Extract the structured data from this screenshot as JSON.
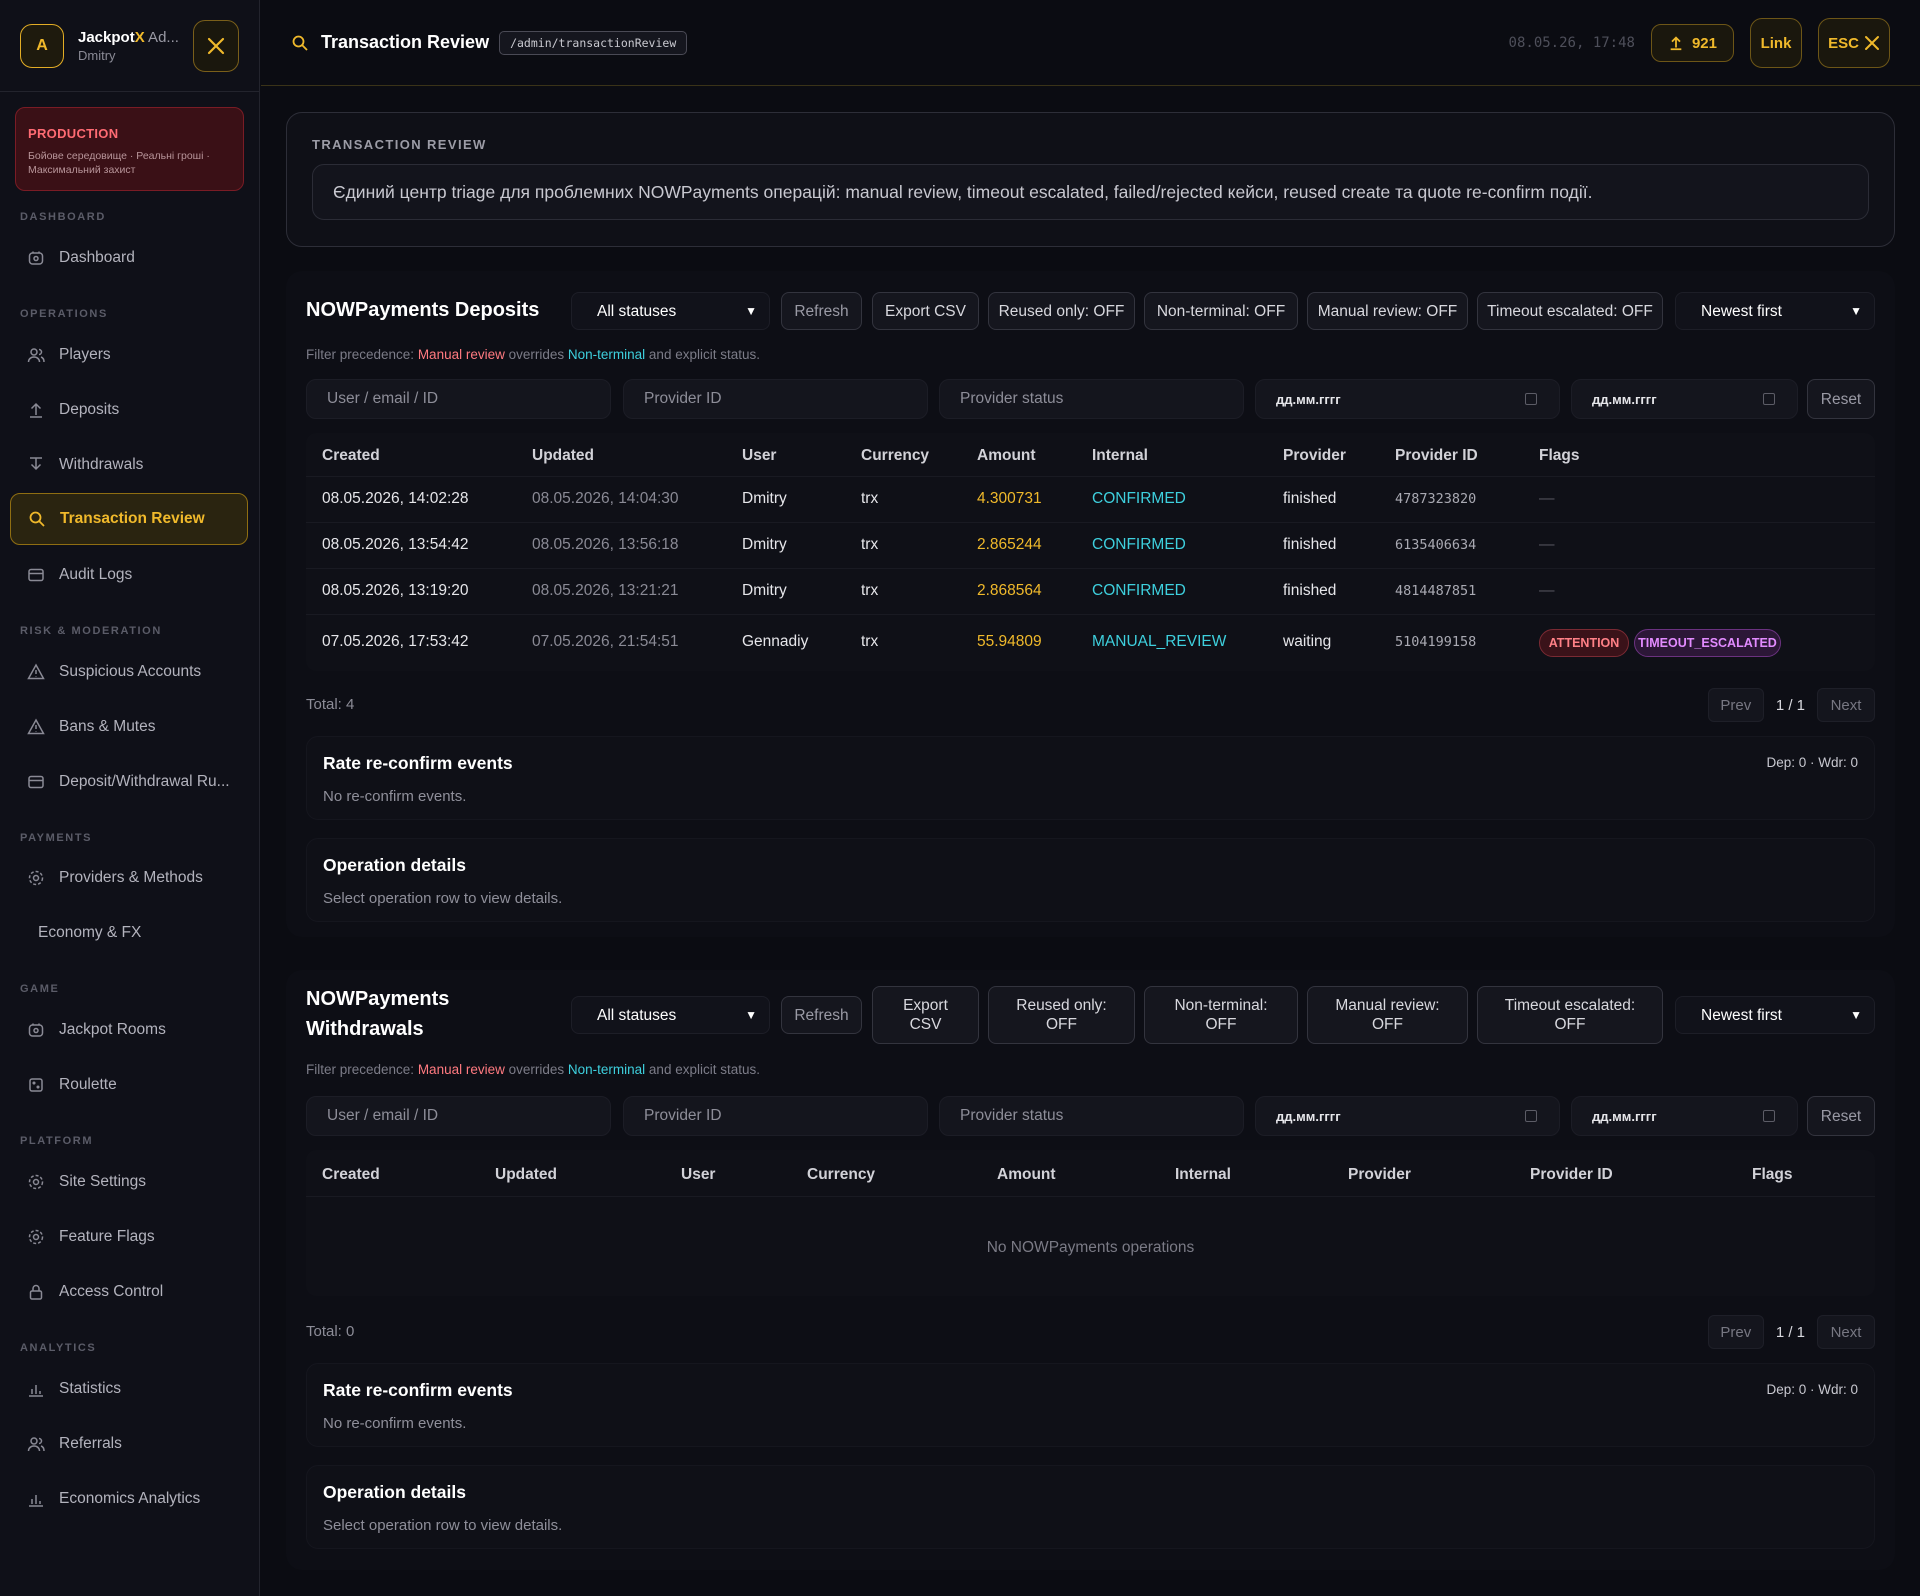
{
  "sidebar": {
    "avatar_letter": "A",
    "brand_pre": "Jackpot",
    "brand_x": "X",
    "brand_post": " Ad...",
    "user": "Dmitry",
    "env": {
      "title": "PRODUCTION",
      "subtitle": "Бойове середовище · Реальні гроші · Максимальний захист"
    },
    "sections": {
      "dashboard": "DASHBOARD",
      "operations": "OPERATIONS",
      "risk": "RISK & MODERATION",
      "payments": "PAYMENTS",
      "game": "GAME",
      "platform": "PLATFORM",
      "analytics": "ANALYTICS"
    },
    "items": {
      "dashboard": "Dashboard",
      "players": "Players",
      "deposits": "Deposits",
      "withdrawals": "Withdrawals",
      "transaction_review": "Transaction Review",
      "audit_logs": "Audit Logs",
      "suspicious": "Suspicious Accounts",
      "bans": "Bans & Mutes",
      "dw_rules": "Deposit/Withdrawal Ru...",
      "providers": "Providers & Methods",
      "economy": "Economy & FX",
      "jackpot_rooms": "Jackpot Rooms",
      "roulette": "Roulette",
      "site_settings": "Site Settings",
      "feature_flags": "Feature Flags",
      "access_control": "Access Control",
      "statistics": "Statistics",
      "referrals": "Referrals",
      "economics": "Economics Analytics"
    }
  },
  "topbar": {
    "title": "Transaction Review",
    "route": "/admin/transactionReview",
    "time": "08.05.26, 17:48",
    "pending_count": "921",
    "link_label": "Link",
    "esc_label": "ESC"
  },
  "intro": {
    "label": "TRANSACTION REVIEW",
    "text": "Єдиний центр triage для проблемних NOWPayments операцій: manual review, timeout escalated, failed/rejected кейси, reused create та quote re-confirm події."
  },
  "common": {
    "status_select": "All statuses",
    "refresh": "Refresh",
    "export": "Export CSV",
    "reused": "Reused only: OFF",
    "nonterminal": "Non-terminal: OFF",
    "manual": "Manual review: OFF",
    "timeout": "Timeout escalated: OFF",
    "sort": "Newest first",
    "hint_pre": "Filter precedence: ",
    "hint_manual": "Manual review",
    "hint_mid": " overrides ",
    "hint_nonterminal": "Non-terminal",
    "hint_post": " and explicit status.",
    "ph_user": "User / email / ID",
    "ph_provider_id": "Provider ID",
    "ph_provider_status": "Provider status",
    "date_ph": "дд.мм.гггг",
    "reset": "Reset",
    "prev": "Prev",
    "next": "Next",
    "page": "1 / 1",
    "reconfirm_title": "Rate re-confirm events",
    "reconfirm_empty": "No re-confirm events.",
    "reconfirm_counts": "Dep: 0 · Wdr: 0",
    "details_title": "Operation details",
    "details_empty": "Select operation row to view details."
  },
  "columns": [
    "Created",
    "Updated",
    "User",
    "Currency",
    "Amount",
    "Internal",
    "Provider",
    "Provider ID",
    "Flags"
  ],
  "deposits": {
    "title": "NOWPayments Deposits",
    "total": "Total: 4",
    "rows": [
      {
        "created": "08.05.2026, 14:02:28",
        "updated": "08.05.2026, 14:04:30",
        "user": "Dmitry",
        "currency": "trx",
        "amount": "4.300731",
        "internal": "CONFIRMED",
        "provider": "finished",
        "provider_id": "4787323820",
        "flags": "—"
      },
      {
        "created": "08.05.2026, 13:54:42",
        "updated": "08.05.2026, 13:56:18",
        "user": "Dmitry",
        "currency": "trx",
        "amount": "2.865244",
        "internal": "CONFIRMED",
        "provider": "finished",
        "provider_id": "6135406634",
        "flags": "—"
      },
      {
        "created": "08.05.2026, 13:19:20",
        "updated": "08.05.2026, 13:21:21",
        "user": "Dmitry",
        "currency": "trx",
        "amount": "2.868564",
        "internal": "CONFIRMED",
        "provider": "finished",
        "provider_id": "4814487851",
        "flags": "—"
      },
      {
        "created": "07.05.2026, 17:53:42",
        "updated": "07.05.2026, 21:54:51",
        "user": "Gennadiy",
        "currency": "trx",
        "amount": "55.94809",
        "internal": "MANUAL_REVIEW",
        "provider": "waiting",
        "provider_id": "5104199158",
        "flag1": "ATTENTION",
        "flag2": "TIMEOUT_ESCALATED"
      }
    ]
  },
  "withdrawals": {
    "title_line1": "NOWPayments",
    "title_line2": "Withdrawals",
    "export_l1": "Export",
    "export_l2": "CSV",
    "reused_l1": "Reused only:",
    "nonterminal_l1": "Non-terminal:",
    "manual_l1": "Manual review:",
    "timeout_l1": "Timeout escalated:",
    "off": "OFF",
    "empty": "No NOWPayments operations",
    "total": "Total: 0"
  },
  "colors": {
    "accent": "#f0b92b",
    "cyan": "#3ed0de",
    "danger": "#ff6b73",
    "purple": "#e28bff"
  }
}
